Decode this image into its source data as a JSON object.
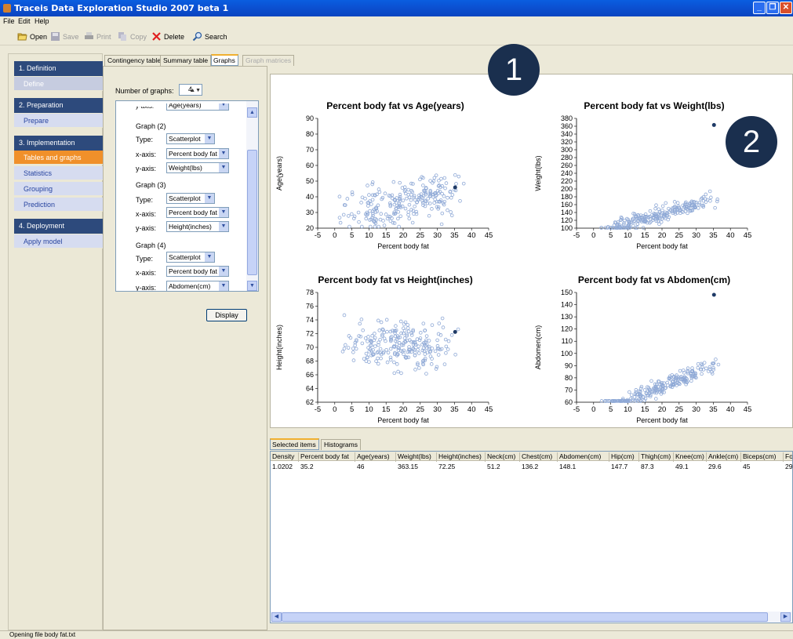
{
  "window": {
    "title": "Traceis Data Exploration Studio 2007 beta 1"
  },
  "menu": [
    "File",
    "Edit",
    "Help"
  ],
  "toolbar": {
    "open": "Open",
    "save": "Save",
    "print": "Print",
    "copy": "Copy",
    "delete": "Delete",
    "search": "Search"
  },
  "nav": {
    "sections": [
      {
        "head": "1. Definition",
        "items": [
          {
            "label": "Define",
            "state": "disabled"
          }
        ]
      },
      {
        "head": "2. Preparation",
        "items": [
          {
            "label": "Prepare",
            "state": "normal"
          }
        ]
      },
      {
        "head": "3. Implementation",
        "items": [
          {
            "label": "Tables and graphs",
            "state": "active"
          },
          {
            "label": "Statistics",
            "state": "normal"
          },
          {
            "label": "Grouping",
            "state": "normal"
          },
          {
            "label": "Prediction",
            "state": "normal"
          }
        ]
      },
      {
        "head": "4. Deployment",
        "items": [
          {
            "label": "Apply model",
            "state": "normal"
          }
        ]
      }
    ]
  },
  "tabs": [
    "Contingency table",
    "Summary table",
    "Graphs",
    "Graph matrices"
  ],
  "form": {
    "num_label": "Number of graphs:",
    "num_value": "4",
    "partial_label": "y-axis:",
    "partial_value": "Age(years)",
    "graphs": [
      {
        "title": "Graph (2)",
        "type": "Scatterplot",
        "x": "Percent body fat",
        "y": "Weight(lbs)"
      },
      {
        "title": "Graph (3)",
        "type": "Scatterplot",
        "x": "Percent body fat",
        "y": "Height(inches)"
      },
      {
        "title": "Graph (4)",
        "type": "Scatterplot",
        "x": "Percent body fat",
        "y": "Abdomen(cm)"
      }
    ],
    "type_label": "Type:",
    "x_label": "x-axis:",
    "y_label": "y-axis:",
    "display_button": "Display"
  },
  "callouts": [
    "1",
    "2"
  ],
  "colors": {
    "point": "#8fa9d6",
    "highlight": "#1f3a66",
    "circle": "#1a2f4e",
    "active_nav": "#f0902a",
    "nav_head": "#2d4a7c"
  },
  "chart_data": [
    {
      "type": "scatter",
      "title": "Percent body fat vs Age(years)",
      "xlabel": "Percent body fat",
      "ylabel": "Age(years)",
      "xlim": [
        -5,
        45
      ],
      "ylim": [
        20,
        90
      ],
      "xticks": [
        -5,
        0,
        5,
        10,
        15,
        20,
        25,
        30,
        35,
        40,
        45
      ],
      "yticks": [
        20,
        30,
        40,
        50,
        60,
        70,
        80,
        90
      ],
      "seed": 11,
      "slope": 0.45,
      "intercept": 36,
      "noise": 11,
      "highlight": [
        35.2,
        46
      ]
    },
    {
      "type": "scatter",
      "title": "Percent body fat vs Weight(lbs)",
      "xlabel": "Percent body fat",
      "ylabel": "Weight(lbs)",
      "xlim": [
        -5,
        45
      ],
      "ylim": [
        100,
        380
      ],
      "xticks": [
        -5,
        0,
        5,
        10,
        15,
        20,
        25,
        30,
        35,
        40,
        45
      ],
      "yticks": [
        100,
        120,
        140,
        160,
        180,
        200,
        220,
        240,
        260,
        280,
        300,
        320,
        340,
        360,
        380
      ],
      "seed": 23,
      "slope": 2.6,
      "intercept": 130,
      "noise": 17,
      "highlight": [
        35.2,
        363.15
      ]
    },
    {
      "type": "scatter",
      "title": "Percent body fat vs Height(inches)",
      "xlabel": "Percent body fat",
      "ylabel": "Height(inches)",
      "xlim": [
        -5,
        45
      ],
      "ylim": [
        62,
        78
      ],
      "xticks": [
        -5,
        0,
        5,
        10,
        15,
        20,
        25,
        30,
        35,
        40,
        45
      ],
      "yticks": [
        62,
        64,
        66,
        68,
        70,
        72,
        74,
        76,
        78
      ],
      "seed": 37,
      "slope": 0.0,
      "intercept": 70.2,
      "noise": 2.5,
      "highlight": [
        35.2,
        72.25
      ]
    },
    {
      "type": "scatter",
      "title": "Percent body fat vs Abdomen(cm)",
      "xlabel": "Percent body fat",
      "ylabel": "Abdomen(cm)",
      "xlim": [
        -5,
        45
      ],
      "ylim": [
        60,
        150
      ],
      "xticks": [
        -5,
        0,
        5,
        10,
        15,
        20,
        25,
        30,
        35,
        40,
        45
      ],
      "yticks": [
        60,
        70,
        80,
        90,
        100,
        110,
        120,
        130,
        140,
        150
      ],
      "seed": 53,
      "slope": 1.25,
      "intercept": 70,
      "noise": 5,
      "highlight": [
        35.2,
        148.1
      ]
    }
  ],
  "bottom_tabs": [
    "Selected items",
    "Histograms"
  ],
  "table": {
    "columns": [
      "Density",
      "Percent body fat",
      "Age(years)",
      "Weight(lbs)",
      "Height(inches)",
      "Neck(cm)",
      "Chest(cm)",
      "Abdomen(cm)",
      "Hip(cm)",
      "Thigh(cm)",
      "Knee(cm)",
      "Ankle(cm)",
      "Biceps(cm)",
      "Fo"
    ],
    "rows": [
      [
        "1.0202",
        "35.2",
        "46",
        "363.15",
        "72.25",
        "51.2",
        "136.2",
        "148.1",
        "147.7",
        "87.3",
        "49.1",
        "29.6",
        "45",
        "29"
      ]
    ]
  },
  "status": "Opening file body fat.txt"
}
